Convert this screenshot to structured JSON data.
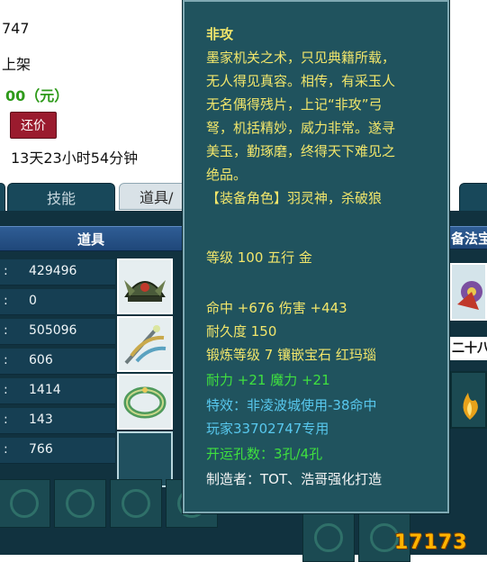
{
  "seller": {
    "id_fragment": "747",
    "status_fragment": "上架",
    "price_fragment": "00（元）",
    "bargain_label": "还价",
    "time_left": "13天23小时54分钟"
  },
  "tabs": [
    {
      "label": "技能"
    },
    {
      "label": "道具/"
    }
  ],
  "inventory": {
    "header": "道具",
    "right_header": "备法宝",
    "right_slot_label": "二十八",
    "stat_colon": ":",
    "stats": [
      "429496",
      "0",
      "505096",
      "606",
      "1414",
      "143",
      "766"
    ]
  },
  "tooltip": {
    "title": "非攻",
    "desc_lines": [
      "墨家机关之术，只见典籍所载，",
      "无人得见真容。相传，有采玉人",
      "无名偶得残片，上记“非攻”弓",
      "弩，机括精妙，威力非常。遂寻",
      "美玉，勤琢磨，终得天下难见之",
      "绝品。"
    ],
    "role_line": "【装备角色】羽灵神，杀破狼",
    "level_line": "等级 100 五行 金",
    "attr_line": "命中 +676 伤害 +443",
    "durability_line": "耐久度 150",
    "forge_line": "锻炼等级 7 镶嵌宝石 红玛瑙",
    "bonus_line": "耐力 +21 魔力 +21",
    "effect_line": "特效：非凌波城使用-38命中",
    "owner_line": "玩家33702747专用",
    "holes_line": "开运孔数：3孔/4孔",
    "maker_line": "制造者：TOT、浩哥强化打造"
  },
  "watermark": "17173",
  "colors": {
    "tooltip_bg": "#20535e",
    "tooltip_title": "#f2e66b",
    "bonus_green": "#3fe03f",
    "effect_cyan": "#58c8ee",
    "price_green": "#2e9a1a",
    "bargain_red": "#9a1b2e"
  }
}
